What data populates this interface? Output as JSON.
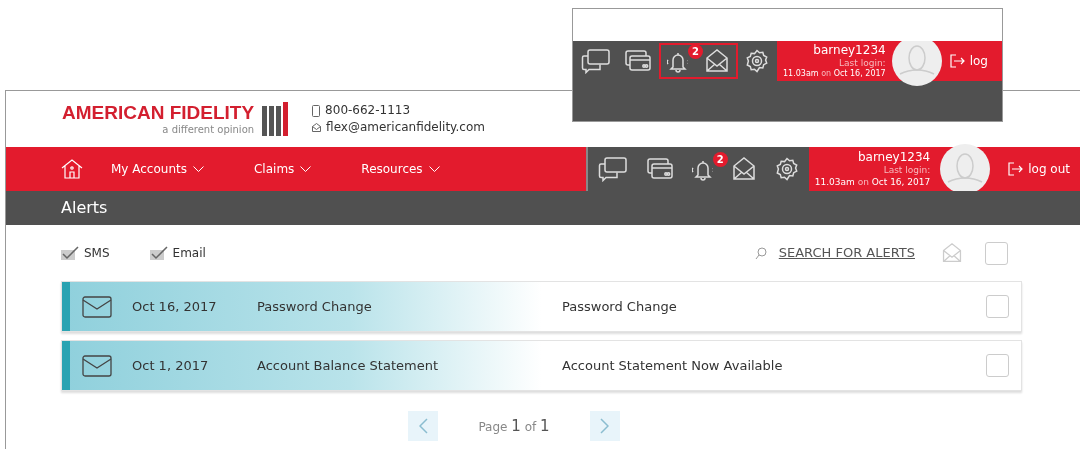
{
  "header": {
    "logo": "AMERICAN FIDELITY",
    "tagline": "a different opinion",
    "phone": "800-662-1113",
    "email": "flex@americanfidelity.com"
  },
  "nav": [
    {
      "label": "My Accounts"
    },
    {
      "label": "Claims"
    },
    {
      "label": "Resources"
    }
  ],
  "toolbar": {
    "badge": "2",
    "username": "barney1234",
    "last_login_label": "Last login:",
    "login_time": "11.03am",
    "login_on": "on",
    "login_date": "Oct 16, 2017",
    "logout": "log out"
  },
  "inset": {
    "badge": "2",
    "username": "barney1234",
    "last_login_label": "Last login:",
    "login_time": "11.03am",
    "login_on": "on",
    "login_date": "Oct 16, 2017",
    "logout": "log"
  },
  "page_title": "Alerts",
  "filters": [
    {
      "label": "SMS",
      "checked": true
    },
    {
      "label": "Email",
      "checked": true
    }
  ],
  "search_link": "SEARCH FOR ALERTS",
  "select_all": {
    "checked": false
  },
  "alerts": [
    {
      "date": "Oct 16, 2017",
      "type": "Password Change",
      "subject": "Password Change",
      "checked": false
    },
    {
      "date": "Oct 1, 2017",
      "type": "Account Balance Statement",
      "subject": "Account Statement Now Available",
      "checked": false
    }
  ],
  "pagination": {
    "label": "Page",
    "current": "1",
    "of": "of",
    "total": "1"
  }
}
